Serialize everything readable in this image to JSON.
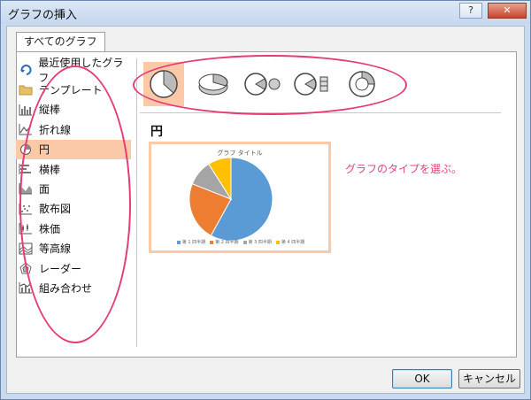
{
  "window": {
    "title": "グラフの挿入",
    "help_glyph": "?",
    "close_glyph": "✕"
  },
  "tab": {
    "label": "すべてのグラフ"
  },
  "chart_types": [
    {
      "label": "最近使用したグラフ",
      "icon": "recent-icon"
    },
    {
      "label": "テンプレート",
      "icon": "folder-icon"
    },
    {
      "label": "縦棒",
      "icon": "column-chart-icon"
    },
    {
      "label": "折れ線",
      "icon": "line-chart-icon"
    },
    {
      "label": "円",
      "icon": "pie-chart-icon",
      "selected": true
    },
    {
      "label": "横棒",
      "icon": "bar-chart-icon"
    },
    {
      "label": "面",
      "icon": "area-chart-icon"
    },
    {
      "label": "散布図",
      "icon": "scatter-chart-icon"
    },
    {
      "label": "株価",
      "icon": "stock-chart-icon"
    },
    {
      "label": "等高線",
      "icon": "surface-chart-icon"
    },
    {
      "label": "レーダー",
      "icon": "radar-chart-icon"
    },
    {
      "label": "組み合わせ",
      "icon": "combo-chart-icon"
    }
  ],
  "subtypes": [
    "pie",
    "3d-pie",
    "pie-of-pie",
    "bar-of-pie",
    "doughnut"
  ],
  "section_title": "円",
  "preview": {
    "chart_title": "グラフ タイトル",
    "legend": [
      "第 1 四半期",
      "第 2 四半期",
      "第 3 四半期",
      "第 4 四半期"
    ]
  },
  "chart_data": {
    "type": "pie",
    "title": "グラフ タイトル",
    "categories": [
      "第 1 四半期",
      "第 2 四半期",
      "第 3 四半期",
      "第 4 四半期"
    ],
    "values": [
      58,
      23,
      10,
      9
    ],
    "colors": [
      "#5b9bd5",
      "#ed7d31",
      "#a5a5a5",
      "#ffc000"
    ]
  },
  "annotation": {
    "text": "グラフのタイプを選ぶ。",
    "color": "#e0437e"
  },
  "buttons": {
    "ok": "OK",
    "cancel": "キャンセル"
  },
  "colors": {
    "selection": "#fbc8a8",
    "ellipse": "#e63b76"
  }
}
